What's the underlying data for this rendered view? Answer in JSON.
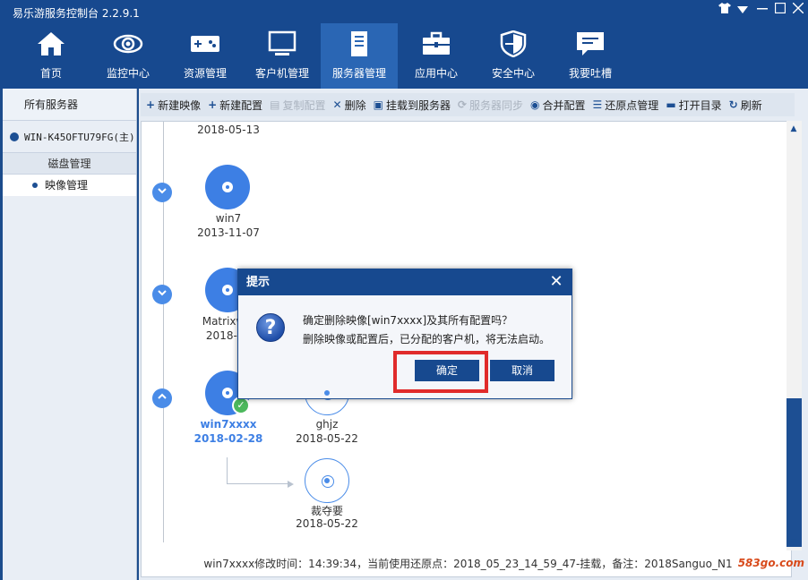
{
  "app": {
    "title": "易乐游服务控制台 2.2.9.1"
  },
  "window_controls": {
    "skin": "shirt-icon",
    "menu": "dropdown-icon",
    "minimize": "minimize-icon",
    "maximize": "maximize-icon",
    "close": "close-icon"
  },
  "nav": {
    "items": [
      {
        "label": "首页",
        "icon": "home-icon"
      },
      {
        "label": "监控中心",
        "icon": "eye-icon"
      },
      {
        "label": "资源管理",
        "icon": "gamepad-icon"
      },
      {
        "label": "客户机管理",
        "icon": "monitor-icon"
      },
      {
        "label": "服务器管理",
        "icon": "server-icon",
        "active": true
      },
      {
        "label": "应用中心",
        "icon": "toolbox-icon"
      },
      {
        "label": "安全中心",
        "icon": "shield-icon"
      },
      {
        "label": "我要吐槽",
        "icon": "chat-icon"
      }
    ]
  },
  "sidebar": {
    "all_servers": "所有服务器",
    "server": "WIN-K45OFTU79FG(主)",
    "disk_mgmt": "磁盘管理",
    "image_mgmt": "映像管理"
  },
  "toolbar": {
    "new_image": "新建映像",
    "new_config": "新建配置",
    "copy_config": "复制配置",
    "delete": "删除",
    "mount": "挂载到服务器",
    "sync": "服务器同步",
    "merge": "合并配置",
    "restore_mgmt": "还原点管理",
    "open_dir": "打开目录",
    "refresh": "刷新"
  },
  "images": [
    {
      "name": "",
      "date": "2018-05-13"
    },
    {
      "name": "win7",
      "date": "2013-11-07"
    },
    {
      "name": "Matrixwin",
      "date": "2018-02"
    },
    {
      "name": "win7xxxx",
      "date": "2018-02-28",
      "selected": true
    }
  ],
  "children": [
    {
      "name": "ghjz",
      "date": "2018-05-22"
    },
    {
      "name": "裁夺要",
      "date": "2018-05-22"
    }
  ],
  "status_text": "win7xxxx修改时间：14:39:34，当前使用还原点：2018_05_23_14_59_47-挂载，备注：2018Sanguo_N1",
  "watermark": "583go.com",
  "dialog": {
    "title": "提示",
    "line1": "确定删除映像[win7xxxx]及其所有配置吗？",
    "line2": "删除映像或配置后，已分配的客户机，将无法启动。",
    "ok": "确定",
    "cancel": "取消",
    "icon": "question-icon"
  },
  "colors": {
    "brand": "#17498f",
    "accent": "#3d7fe4",
    "success": "#4cb85c",
    "highlight": "#e02b2b"
  }
}
